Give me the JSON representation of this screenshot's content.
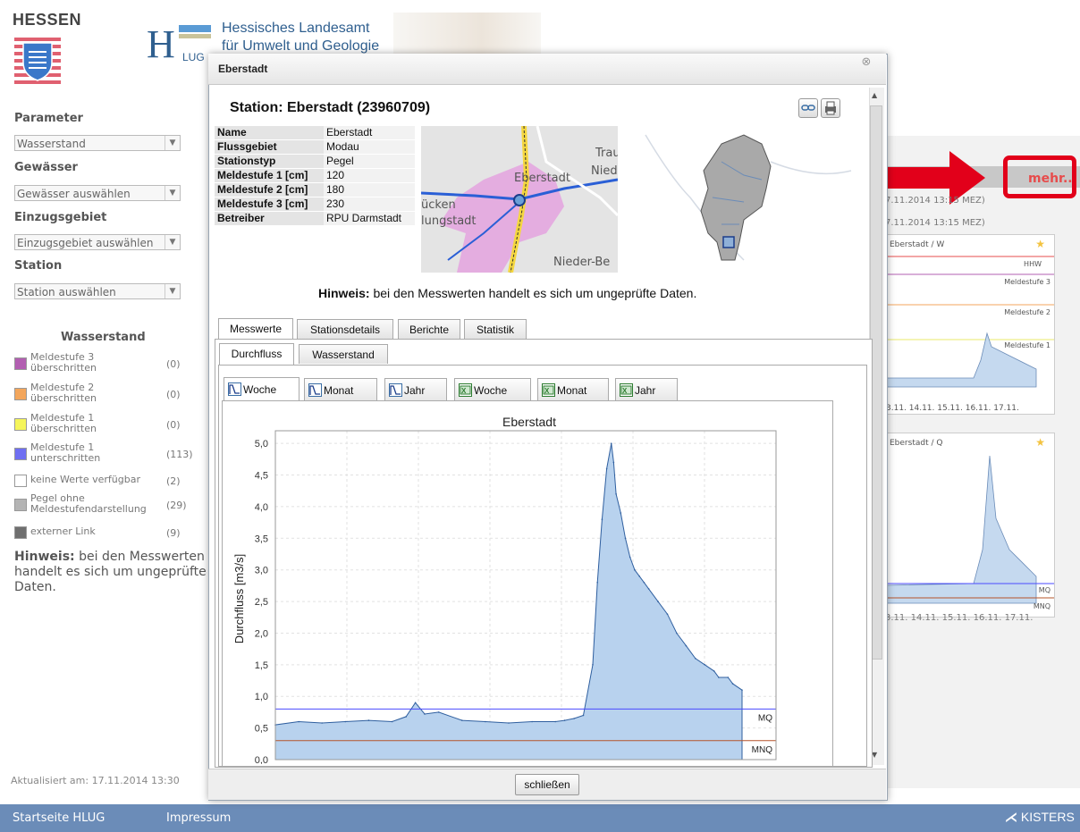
{
  "header": {
    "state_name": "HESSEN",
    "agency_line1": "Hessisches Landesamt",
    "agency_line2": "für Umwelt und Geologie"
  },
  "sidebar": {
    "parameter_label": "Parameter",
    "parameter_value": "Wasserstand",
    "gewaesser_label": "Gewässer",
    "gewaesser_placeholder": "Gewässer auswählen",
    "einzugsgebiet_label": "Einzugsgebiet",
    "einzugsgebiet_placeholder": "Einzugsgebiet auswählen",
    "station_label": "Station",
    "station_placeholder": "Station auswählen",
    "legend_title": "Wasserstand",
    "legend": [
      {
        "label": "Meldestufe 3 überschritten",
        "count": "(0)",
        "color": "#b25fb1"
      },
      {
        "label": "Meldestufe 2 überschritten",
        "count": "(0)",
        "color": "#f3a65c"
      },
      {
        "label": "Meldestufe 1 überschritten",
        "count": "(0)",
        "color": "#f5f55a"
      },
      {
        "label": "Meldestufe 1 unterschritten",
        "count": "(113)",
        "color": "#6f6ff2"
      },
      {
        "label": "keine Werte verfügbar",
        "count": "(2)",
        "color": "#ffffff"
      },
      {
        "label": "Pegel ohne Meldestufendarstellung",
        "count": "(29)",
        "color": "#b4b4b4"
      },
      {
        "label": "externer Link",
        "count": "(9)",
        "color": "#6f6f6f"
      }
    ],
    "hinweis_bold": "Hinweis:",
    "hinweis_text": "bei den Messwerten handelt es sich um ungeprüfte Daten.",
    "updated": "Aktualisiert am: 17.11.2014  13:30"
  },
  "footer_nav": {
    "home": "Startseite HLUG",
    "impressum": "Impressum",
    "vendor": "KISTERS"
  },
  "right_panel": {
    "more_link": "mehr...",
    "time1": "7.11.2014 13:15 MEZ)",
    "time2": "7.11.2014 13:15 MEZ)",
    "chart1_title": "Eberstadt / W",
    "chart1_lines": [
      "HHW",
      "Meldestufe 3",
      "Meldestufe 2",
      "Meldestufe 1"
    ],
    "chart2_title": "Eberstadt / Q",
    "chart2_lines": [
      "MQ",
      "MNQ"
    ],
    "x_ticks": "3.11.  14.11.  15.11.  16.11.  17.11."
  },
  "dialog": {
    "title": "Eberstadt",
    "station_heading": "Station: Eberstadt (23960709)",
    "info": [
      {
        "key": "Name",
        "value": "Eberstadt"
      },
      {
        "key": "Flussgebiet",
        "value": "Modau"
      },
      {
        "key": "Stationstyp",
        "value": "Pegel"
      },
      {
        "key": "Meldestufe 1 [cm]",
        "value": "120"
      },
      {
        "key": "Meldestufe 2 [cm]",
        "value": "180"
      },
      {
        "key": "Meldestufe 3 [cm]",
        "value": "230"
      },
      {
        "key": "Betreiber",
        "value": "RPU Darmstadt"
      }
    ],
    "map_labels": [
      "Eberstadt",
      "Trau",
      "Nied",
      "ücken",
      "lungstadt",
      "Nieder-Be"
    ],
    "hinweis_bold": "Hinweis:",
    "hinweis_text": " bei den Messwerten handelt es sich um ungeprüfte Daten.",
    "tabs": [
      "Messwerte",
      "Stationsdetails",
      "Berichte",
      "Statistik"
    ],
    "subtabs": [
      "Durchfluss",
      "Wasserstand"
    ],
    "period_tabs": [
      "Woche",
      "Monat",
      "Jahr",
      "Woche",
      "Monat",
      "Jahr"
    ],
    "close_button": "schließen"
  },
  "chart_data": {
    "type": "area",
    "title": "Eberstadt",
    "ylabel": "Durchfluss [m3/s]",
    "xlabel": "",
    "ylim": [
      0,
      5.2
    ],
    "yticks": [
      "0,0",
      "0,5",
      "1,0",
      "1,5",
      "2,0",
      "2,5",
      "3,0",
      "3,5",
      "4,0",
      "4,5",
      "5,0"
    ],
    "grid": true,
    "reference_lines": [
      {
        "name": "MQ",
        "value": 0.8,
        "color": "#4a4aff"
      },
      {
        "name": "MNQ",
        "value": 0.3,
        "color": "#b5542a"
      }
    ],
    "x": [
      0,
      0.05,
      0.1,
      0.15,
      0.2,
      0.25,
      0.28,
      0.3,
      0.32,
      0.35,
      0.4,
      0.45,
      0.5,
      0.55,
      0.6,
      0.62,
      0.64,
      0.66,
      0.68,
      0.69,
      0.7,
      0.71,
      0.72,
      0.725,
      0.73,
      0.74,
      0.75,
      0.76,
      0.77,
      0.78,
      0.79,
      0.8,
      0.82,
      0.84,
      0.86,
      0.88,
      0.9,
      0.92,
      0.94,
      0.95,
      0.97,
      0.98,
      1.0
    ],
    "values": [
      0.55,
      0.6,
      0.58,
      0.6,
      0.62,
      0.6,
      0.68,
      0.9,
      0.72,
      0.75,
      0.62,
      0.6,
      0.58,
      0.6,
      0.6,
      0.62,
      0.65,
      0.7,
      1.5,
      2.8,
      3.8,
      4.6,
      5.0,
      4.7,
      4.2,
      3.9,
      3.5,
      3.2,
      3.0,
      2.9,
      2.8,
      2.7,
      2.5,
      2.3,
      2.0,
      1.8,
      1.6,
      1.5,
      1.4,
      1.3,
      1.3,
      1.2,
      1.1
    ]
  }
}
